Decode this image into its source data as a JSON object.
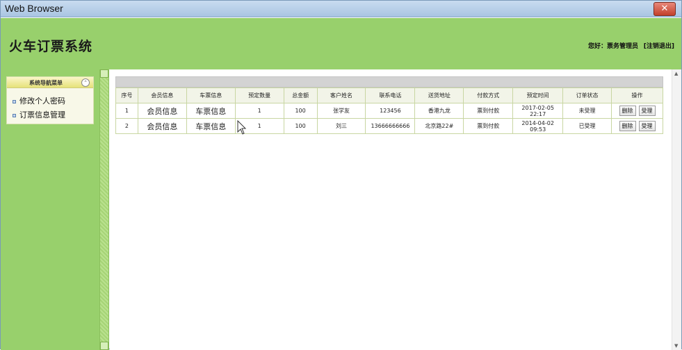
{
  "window": {
    "title": "Web Browser",
    "close_label": "✕"
  },
  "header": {
    "app_title": "火车订票系统",
    "greeting": "您好：票务管理员",
    "logout": "[注销退出]"
  },
  "sidebar": {
    "title": "系统导航菜单",
    "items": [
      {
        "label": "修改个人密码"
      },
      {
        "label": "订票信息管理"
      }
    ]
  },
  "table": {
    "headers": [
      "序号",
      "会员信息",
      "车票信息",
      "预定数量",
      "总金额",
      "客户姓名",
      "联系电话",
      "送货地址",
      "付款方式",
      "预定时间",
      "订单状态",
      "操作"
    ],
    "rows": [
      {
        "no": "1",
        "member": "会员信息",
        "ticket": "车票信息",
        "qty": "1",
        "amount": "100",
        "name": "张学友",
        "phone": "123456",
        "address": "香港九龙",
        "payment": "票到付款",
        "time": "2017-02-05 22:17",
        "status": "未受理",
        "delete": "删除",
        "accept": "受理"
      },
      {
        "no": "2",
        "member": "会员信息",
        "ticket": "车票信息",
        "qty": "1",
        "amount": "100",
        "name": "刘三",
        "phone": "13666666666",
        "address": "北京路22#",
        "payment": "票到付款",
        "time": "2014-04-02 09:53",
        "status": "已受理",
        "delete": "删除",
        "accept": "受理"
      }
    ]
  },
  "colors": {
    "header_bg": "#98d06c",
    "menu_head": "#e6e27a"
  }
}
